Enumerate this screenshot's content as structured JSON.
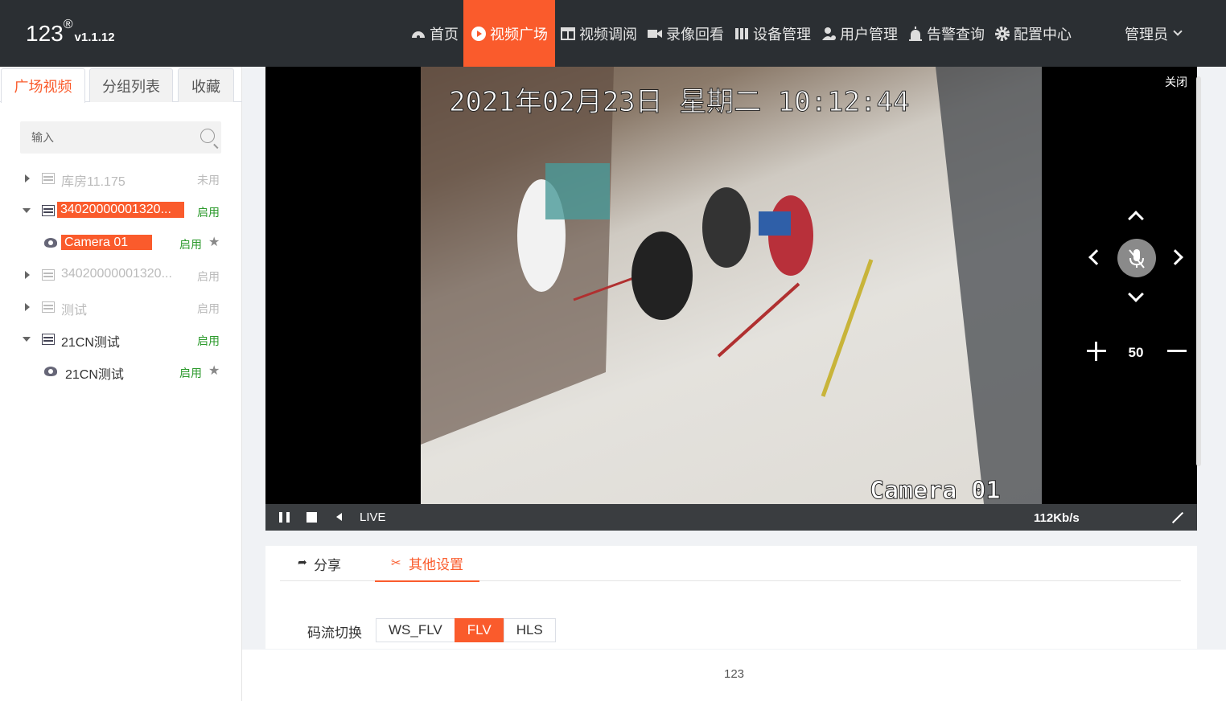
{
  "header": {
    "brand": "123",
    "brand_mark": "®",
    "version": "v1.1.12",
    "nav": [
      {
        "label": "首页",
        "icon": "dashboard-icon"
      },
      {
        "label": "视频广场",
        "icon": "play-icon",
        "active": true
      },
      {
        "label": "视频调阅",
        "icon": "grid-icon"
      },
      {
        "label": "录像回看",
        "icon": "video-camera-icon"
      },
      {
        "label": "设备管理",
        "icon": "devices-icon"
      },
      {
        "label": "用户管理",
        "icon": "user-icon"
      },
      {
        "label": "告警查询",
        "icon": "alarm-icon"
      },
      {
        "label": "配置中心",
        "icon": "gear-icon"
      }
    ],
    "user": "管理员"
  },
  "sidebar": {
    "tabs": [
      "广场视频",
      "分组列表",
      "收藏"
    ],
    "search_placeholder": "输入",
    "tree": [
      {
        "label": "库房11.175",
        "status": "未用",
        "type": "device",
        "expanded": false,
        "dim": true
      },
      {
        "label": "34020000001320...",
        "status": "启用",
        "type": "device",
        "expanded": true,
        "selected": true
      },
      {
        "label": "Camera 01",
        "status": "启用",
        "type": "camera",
        "selected": true
      },
      {
        "label": "34020000001320...",
        "status": "启用",
        "type": "device",
        "expanded": false,
        "dim": true
      },
      {
        "label": "测试",
        "status": "启用",
        "type": "device",
        "expanded": false,
        "dim": true
      },
      {
        "label": "21CN测试",
        "status": "启用",
        "type": "device",
        "expanded": true
      },
      {
        "label": "21CN测试",
        "status": "启用",
        "type": "camera"
      }
    ]
  },
  "video": {
    "close_label": "关闭",
    "zoom_value": "50",
    "live_label": "LIVE",
    "bitrate": "112Kb/s"
  },
  "panel": {
    "tabs": [
      {
        "label": "分享",
        "icon": "share-icon"
      },
      {
        "label": "其他设置",
        "icon": "tools-icon",
        "active": true
      }
    ],
    "stream_label": "码流切换",
    "stream_options": [
      "WS_FLV",
      "FLV",
      "HLS"
    ],
    "stream_selected": "FLV"
  },
  "footer": {
    "text": "123"
  },
  "colors": {
    "accent": "#fa5b2c",
    "header_bg": "#2b2f33",
    "status_on": "#2c9a2c"
  }
}
